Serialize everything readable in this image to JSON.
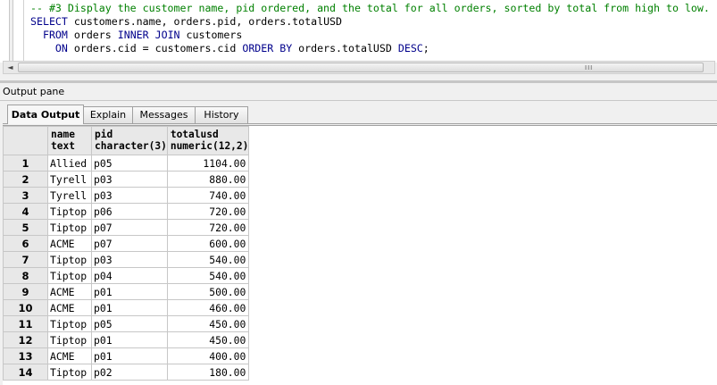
{
  "editor": {
    "comment": "-- #3 Display the customer name, pid ordered, and the total for all orders, sorted by total from high to low.",
    "line2_kw": "SELECT",
    "line2_rest": " customers.name, orders.pid, orders.totalUSD",
    "line3_kw": "FROM",
    "line3_mid": " orders ",
    "line3_kw2": "INNER JOIN",
    "line3_rest": " customers",
    "line4_kw": "ON",
    "line4_mid": " orders.cid = customers.cid ",
    "line4_kw2": "ORDER BY",
    "line4_mid2": " orders.totalUSD ",
    "line4_kw3": "DESC",
    "line4_end": ";"
  },
  "scrollbar": {
    "left_arrow": "◄",
    "grip": "III"
  },
  "output_pane": {
    "title": "Output pane"
  },
  "tabs": [
    {
      "label": "Data Output",
      "active": true
    },
    {
      "label": "Explain"
    },
    {
      "label": "Messages"
    },
    {
      "label": "History"
    }
  ],
  "grid": {
    "columns": [
      {
        "name": "name",
        "type": "text"
      },
      {
        "name": "pid",
        "type": "character(3)"
      },
      {
        "name": "totalusd",
        "type": "numeric(12,2)"
      }
    ],
    "rows": [
      {
        "n": "1",
        "name": "Allied",
        "pid": "p05",
        "total": "1104.00"
      },
      {
        "n": "2",
        "name": "Tyrell",
        "pid": "p03",
        "total": "880.00"
      },
      {
        "n": "3",
        "name": "Tyrell",
        "pid": "p03",
        "total": "740.00"
      },
      {
        "n": "4",
        "name": "Tiptop",
        "pid": "p06",
        "total": "720.00"
      },
      {
        "n": "5",
        "name": "Tiptop",
        "pid": "p07",
        "total": "720.00"
      },
      {
        "n": "6",
        "name": "ACME",
        "pid": "p07",
        "total": "600.00"
      },
      {
        "n": "7",
        "name": "Tiptop",
        "pid": "p03",
        "total": "540.00"
      },
      {
        "n": "8",
        "name": "Tiptop",
        "pid": "p04",
        "total": "540.00"
      },
      {
        "n": "9",
        "name": "ACME",
        "pid": "p01",
        "total": "500.00"
      },
      {
        "n": "10",
        "name": "ACME",
        "pid": "p01",
        "total": "460.00"
      },
      {
        "n": "11",
        "name": "Tiptop",
        "pid": "p05",
        "total": "450.00"
      },
      {
        "n": "12",
        "name": "Tiptop",
        "pid": "p01",
        "total": "450.00"
      },
      {
        "n": "13",
        "name": "ACME",
        "pid": "p01",
        "total": "400.00"
      },
      {
        "n": "14",
        "name": "Tiptop",
        "pid": "p02",
        "total": "180.00"
      }
    ]
  }
}
